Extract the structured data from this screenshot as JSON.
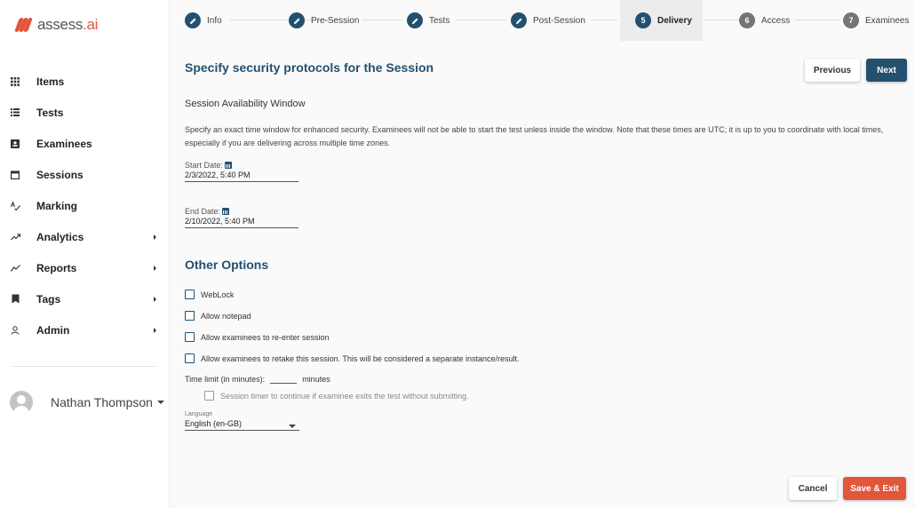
{
  "brand": {
    "name": "assess",
    "suffix": ".ai",
    "color": "#e0573b"
  },
  "sidebar": {
    "items": [
      {
        "label": "Items",
        "icon": "grid-icon",
        "submenu": false
      },
      {
        "label": "Tests",
        "icon": "list-icon",
        "submenu": false
      },
      {
        "label": "Examinees",
        "icon": "id-card-icon",
        "submenu": false
      },
      {
        "label": "Sessions",
        "icon": "calendar-icon",
        "submenu": false
      },
      {
        "label": "Marking",
        "icon": "spellcheck-icon",
        "submenu": false
      },
      {
        "label": "Analytics",
        "icon": "trending-up-icon",
        "submenu": true
      },
      {
        "label": "Reports",
        "icon": "chart-line-icon",
        "submenu": true
      },
      {
        "label": "Tags",
        "icon": "bookmark-icon",
        "submenu": true
      },
      {
        "label": "Admin",
        "icon": "user-icon",
        "submenu": true
      }
    ],
    "user_name": "Nathan Thompson"
  },
  "stepper": {
    "steps": [
      {
        "label": "Info",
        "state": "complete",
        "marker": "pencil"
      },
      {
        "label": "Pre-Session",
        "state": "complete",
        "marker": "pencil"
      },
      {
        "label": "Tests",
        "state": "complete",
        "marker": "pencil"
      },
      {
        "label": "Post-Session",
        "state": "complete",
        "marker": "pencil"
      },
      {
        "label": "Delivery",
        "state": "active",
        "marker": "5"
      },
      {
        "label": "Access",
        "state": "pending",
        "marker": "6"
      },
      {
        "label": "Examinees",
        "state": "pending",
        "marker": "7"
      }
    ]
  },
  "main": {
    "title": "Specify security protocols for the Session",
    "previous_label": "Previous",
    "next_label": "Next",
    "availability": {
      "heading": "Session Availability Window",
      "description": "Specify an exact time window for enhanced security. Examinees will not be able to start the test unless inside the window. Note that these times are UTC; it is up to you to coordinate with local times, especially if you are delivering across multiple time zones.",
      "start_label": "Start Date:",
      "start_value": "2/3/2022, 5:40 PM",
      "end_label": "End Date:",
      "end_value": "2/10/2022, 5:40 PM"
    },
    "other_options": {
      "heading": "Other Options",
      "checkboxes": [
        {
          "label": "WebLock",
          "checked": false
        },
        {
          "label": "Allow notepad",
          "checked": false
        },
        {
          "label": "Allow examinees to re-enter session",
          "checked": false
        },
        {
          "label": "Allow examinees to retake this session. This will be considered a separate instance/result.",
          "checked": false
        }
      ],
      "time_limit_label": "Time limit (in minutes):",
      "time_limit_value": "",
      "time_limit_unit": "minutes",
      "timer_continue_label": "Session timer to continue if examinee exits the test without submitting.",
      "language_label": "Language",
      "language_value": "English (en-GB)"
    },
    "cancel_label": "Cancel",
    "save_exit_label": "Save & Exit"
  },
  "colors": {
    "primary": "#24506f",
    "accent": "#e0573b"
  }
}
